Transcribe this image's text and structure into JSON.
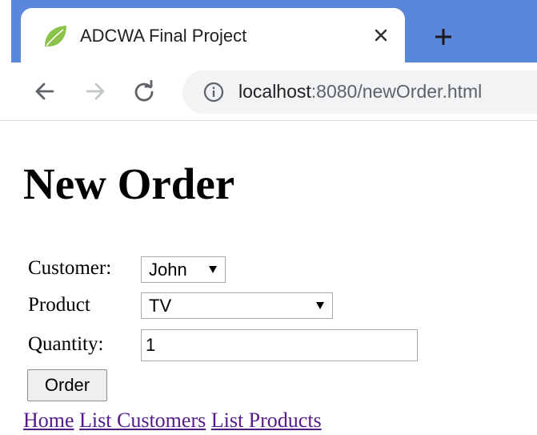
{
  "browser": {
    "tab_title": "ADCWA Final Project",
    "url_host": "localhost",
    "url_path": ":8080/newOrder.html",
    "colors": {
      "tabstrip": "#5b87da",
      "omnibox": "#f1f3f4"
    },
    "icons": {
      "favicon": "spring-leaf-icon",
      "close": "close-icon",
      "new_tab": "plus-icon",
      "back": "back-arrow-icon",
      "forward": "forward-arrow-icon",
      "reload": "reload-icon",
      "info": "info-icon"
    }
  },
  "page": {
    "title": "New Order",
    "form": {
      "customer_label": "Customer:",
      "customer_value": "John",
      "product_label": "Product",
      "product_value": "TV",
      "quantity_label": "Quantity:",
      "quantity_value": "1",
      "submit_label": "Order"
    },
    "links": [
      "Home",
      "List Customers",
      "List Products"
    ],
    "link_color": "#551a8b"
  }
}
